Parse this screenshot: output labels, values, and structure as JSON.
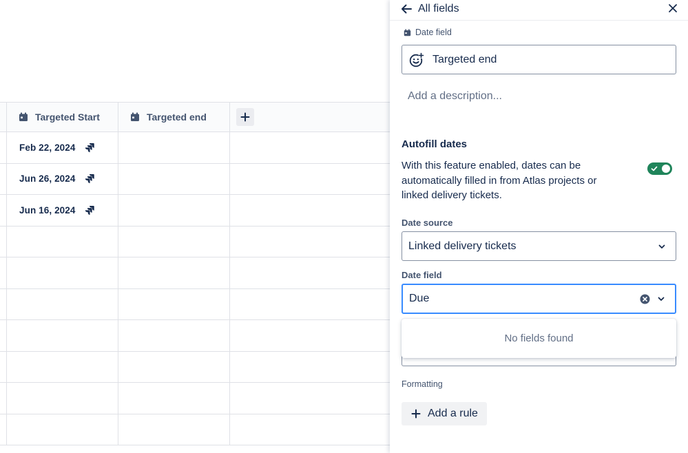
{
  "table": {
    "columns": [
      {
        "label": "Targeted Start",
        "icon": "calendar-icon"
      },
      {
        "label": "Targeted end",
        "icon": "calendar-icon"
      }
    ],
    "add_column_icon": "plus-icon",
    "rows": [
      {
        "targeted_start": "Feb 22, 2024",
        "icon": "jira-icon"
      },
      {
        "targeted_start": "Jun 26, 2024",
        "icon": "jira-icon"
      },
      {
        "targeted_start": "Jun 16, 2024",
        "icon": "jira-icon"
      }
    ],
    "empty_row_count": 7
  },
  "panel": {
    "title": "All fields",
    "field_type": "Date field",
    "field_name": "Targeted end",
    "description_placeholder": "Add a description...",
    "autofill": {
      "title": "Autofill dates",
      "description": "With this feature enabled, dates can be automatically filled in from Atlas projects or linked delivery tickets.",
      "enabled": true
    },
    "date_source": {
      "label": "Date source",
      "value": "Linked delivery tickets"
    },
    "date_field": {
      "label": "Date field",
      "value": "Due",
      "menu_empty_text": "No fields found"
    },
    "formatting": {
      "label": "Formatting",
      "add_rule_label": "Add a rule"
    }
  },
  "colors": {
    "toggle_on": "#1f845a",
    "focus_border": "#388bff",
    "text_primary": "#172b4d",
    "text_subtle": "#44546f"
  }
}
